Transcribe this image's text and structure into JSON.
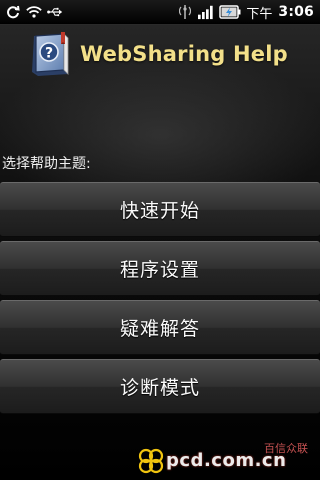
{
  "status_bar": {
    "left_icons": [
      "sync-icon",
      "wifi-icon",
      "usb-icon"
    ],
    "right_icons": [
      "location-icon",
      "signal-icon",
      "battery-charging-icon"
    ],
    "ampm": "下午",
    "time": "3:06"
  },
  "header": {
    "icon": "help-book-icon",
    "title": "WebSharing Help"
  },
  "prompt": "选择帮助主题:",
  "menu": [
    {
      "label": "快速开始"
    },
    {
      "label": "程序设置"
    },
    {
      "label": "疑难解答"
    },
    {
      "label": "诊断模式"
    }
  ],
  "watermark": {
    "text": "pcd.com.cn",
    "cn_text": "百信众联",
    "colors": {
      "accent": "#c0392b",
      "logo": "#f1c40f"
    }
  },
  "colors": {
    "title": "#f3e08a",
    "button_top": "#4b4b4b",
    "button_bottom": "#1c1c1c",
    "background": "#000000"
  }
}
